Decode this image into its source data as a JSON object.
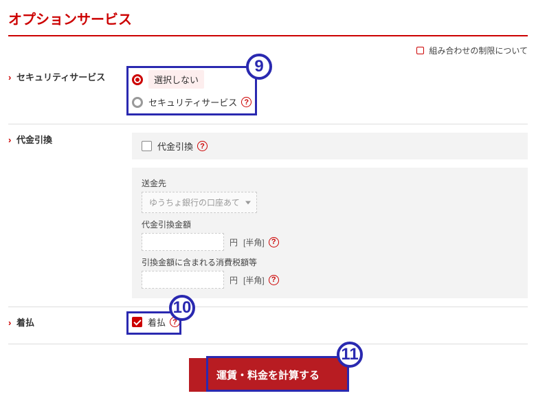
{
  "page_title": "オプションサービス",
  "top_note": {
    "label": "組み合わせの制限について"
  },
  "sections": {
    "security": {
      "title": "セキュリティサービス",
      "options": [
        {
          "label": "選択しない",
          "selected": true
        },
        {
          "label": "セキュリティサービス",
          "selected": false,
          "help": true
        }
      ]
    },
    "daibiki": {
      "title": "代金引換",
      "checkbox_label": "代金引換",
      "checked": false,
      "remittance": {
        "label": "送金先",
        "select_value": "ゆうちょ銀行の口座あて"
      },
      "amount": {
        "label": "代金引換金額",
        "unit": "円",
        "note": "[半角]"
      },
      "tax": {
        "label": "引換金額に含まれる消費税額等",
        "unit": "円",
        "note": "[半角]"
      }
    },
    "chakubarai": {
      "title": "着払",
      "checkbox_label": "着払",
      "checked": true
    }
  },
  "calc_button": "運賃・料金を計算する",
  "callouts": {
    "c9": "9",
    "c10": "10",
    "c11": "11"
  }
}
